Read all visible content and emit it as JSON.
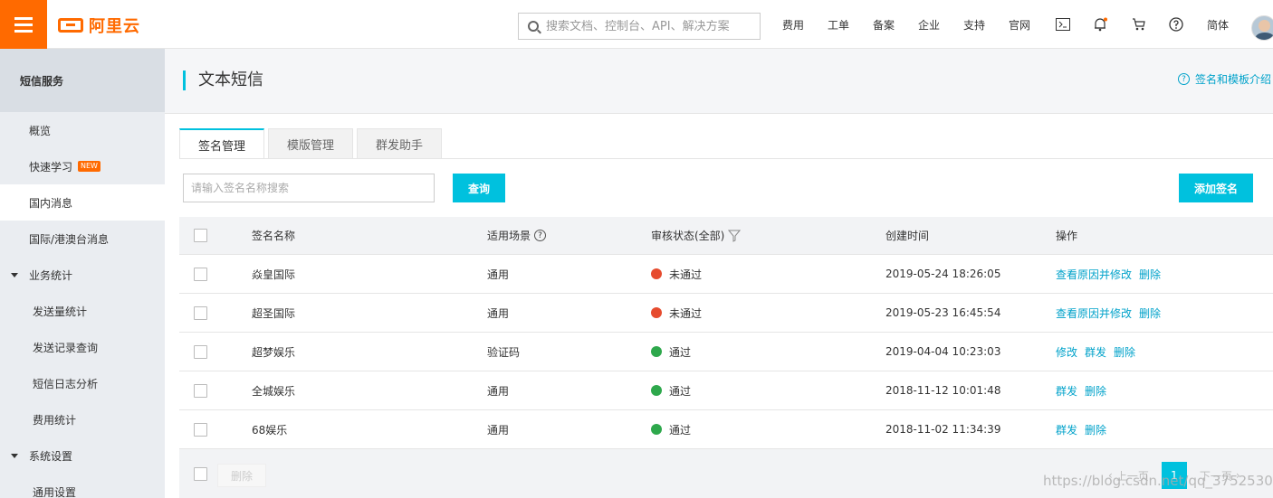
{
  "topbar": {
    "logo_text": "阿里云",
    "search_placeholder": "搜索文档、控制台、API、解决方案",
    "nav_items": [
      "费用",
      "工单",
      "备案",
      "企业",
      "支持",
      "官网"
    ],
    "lang": "简体",
    "icons": [
      "terminal-icon",
      "bell-icon",
      "cart-icon",
      "help-icon"
    ]
  },
  "sidebar": {
    "title": "短信服务",
    "overview": "概览",
    "quick_learn": "快速学习",
    "new_badge": "NEW",
    "domestic": "国内消息",
    "international": "国际/港澳台消息",
    "stats_group": "业务统计",
    "send_stats": "发送量统计",
    "send_records": "发送记录查询",
    "log_analysis": "短信日志分析",
    "cost_stats": "费用统计",
    "settings_group": "系统设置",
    "general_settings": "通用设置"
  },
  "main": {
    "title": "文本短信",
    "help_link": "签名和模板介绍",
    "tabs": [
      "签名管理",
      "模版管理",
      "群发助手"
    ],
    "filter_placeholder": "请输入签名名称搜索",
    "query_button": "查询",
    "add_button": "添加签名"
  },
  "table": {
    "headers": {
      "name": "签名名称",
      "scene": "适用场景",
      "status": "审核状态(全部)",
      "created": "创建时间",
      "ops": "操作"
    },
    "rows": [
      {
        "name": "焱皇国际",
        "scene": "通用",
        "status": "未通过",
        "status_color": "#e64b2e",
        "created": "2019-05-24 18:26:05",
        "ops": [
          "查看原因并修改",
          "删除"
        ]
      },
      {
        "name": "超圣国际",
        "scene": "通用",
        "status": "未通过",
        "status_color": "#e64b2e",
        "created": "2019-05-23 16:45:54",
        "ops": [
          "查看原因并修改",
          "删除"
        ]
      },
      {
        "name": "超梦娱乐",
        "scene": "验证码",
        "status": "通过",
        "status_color": "#2ea84c",
        "created": "2019-04-04 10:23:03",
        "ops": [
          "修改",
          "群发",
          "删除"
        ]
      },
      {
        "name": "全城娱乐",
        "scene": "通用",
        "status": "通过",
        "status_color": "#2ea84c",
        "created": "2018-11-12 10:01:48",
        "ops": [
          "群发",
          "删除"
        ]
      },
      {
        "name": "68娱乐",
        "scene": "通用",
        "status": "通过",
        "status_color": "#2ea84c",
        "created": "2018-11-02 11:34:39",
        "ops": [
          "群发",
          "删除"
        ]
      }
    ],
    "footer": {
      "delete_button": "删除",
      "prev": "上一页",
      "current_page": "1",
      "next": "下一页"
    }
  },
  "watermark": "https://blog.csdn.net/qq_37525302"
}
